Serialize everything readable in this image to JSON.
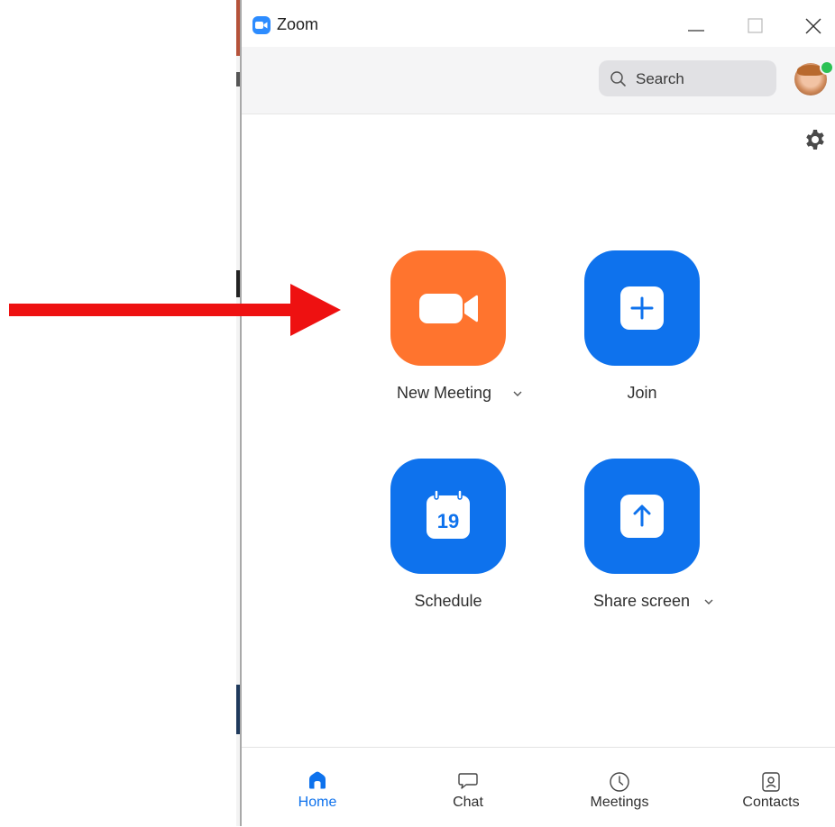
{
  "window": {
    "title": "Zoom"
  },
  "header": {
    "search_placeholder": "Search",
    "presence_status": "online",
    "presence_color": "#2bc154"
  },
  "main": {
    "tiles": [
      {
        "label": "New Meeting",
        "icon": "video-camera-icon",
        "color": "#ff742e",
        "has_dropdown": true
      },
      {
        "label": "Join",
        "icon": "plus-icon",
        "color": "#0e72ed",
        "has_dropdown": false
      },
      {
        "label": "Schedule",
        "icon": "calendar-icon",
        "icon_text": "19",
        "color": "#0e72ed",
        "has_dropdown": false
      },
      {
        "label": "Share screen",
        "icon": "arrow-up-icon",
        "color": "#0e72ed",
        "has_dropdown": true
      }
    ]
  },
  "footer": {
    "tabs": [
      {
        "label": "Home",
        "icon": "home-icon",
        "active": true
      },
      {
        "label": "Chat",
        "icon": "chat-bubble-icon",
        "active": false
      },
      {
        "label": "Meetings",
        "icon": "clock-icon",
        "active": false
      },
      {
        "label": "Contacts",
        "icon": "contact-card-icon",
        "active": false
      }
    ]
  },
  "annotation": {
    "arrow_color": "#ee1111",
    "points_to": "New Meeting"
  },
  "colors": {
    "accent_blue": "#0e72ed",
    "new_meeting_orange": "#ff742e"
  }
}
